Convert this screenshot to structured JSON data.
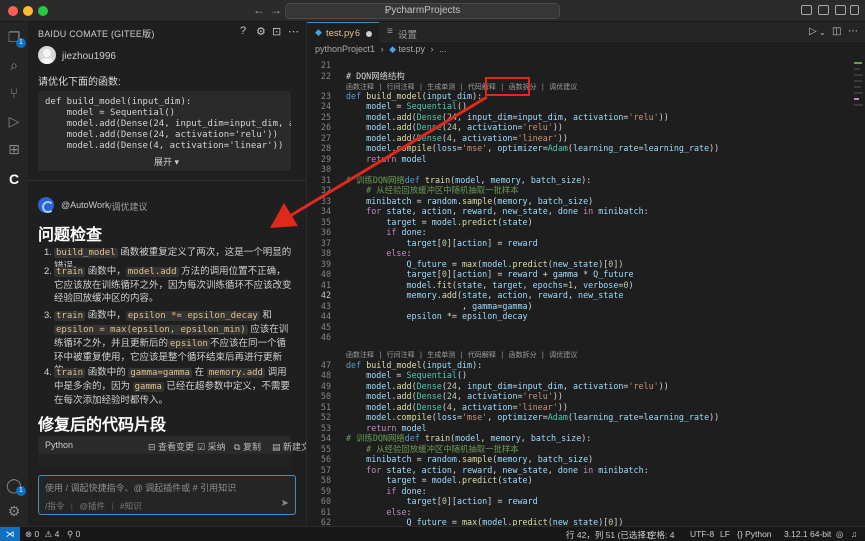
{
  "titlebar": {
    "search_text": "PycharmProjects",
    "back_icon": "arrow-left-icon",
    "forward_icon": "arrow-right-icon"
  },
  "panel": {
    "title": "BAIDU COMATE (GITEE版)",
    "user_name": "jiezhou1996",
    "user_message": "请优化下面的函数:",
    "code_lines": [
      "def build_model(input_dim):",
      "    model = Sequential()",
      "    model.add(Dense(24, input_dim=input_dim, activation=",
      "    model.add(Dense(24, activation='relu'))",
      "    model.add(Dense(4, activation='linear'))"
    ],
    "expand_label": "展开 ▾",
    "ai_name": "@AutoWork",
    "ai_command": "/调优建议",
    "heading_problems": "问题检查",
    "items": [
      {
        "num": "1.",
        "code": "build_model",
        "text": " 函数被重复定义了两次，这是一个明显的错误。"
      },
      {
        "num": "2.",
        "pre": "train",
        "mid1": " 函数中，",
        "code": "model.add",
        "text": " 方法的调用位置不正确，它应该放在训练循环之外，因为每次训练循环不应该改变经验回放缓冲区的内容。"
      },
      {
        "num": "3.",
        "pre": "train",
        "mid1": " 函数中，",
        "code": "epsilon *= epsilon_decay",
        "mid2": " 和 ",
        "code2": "epsilon = max(epsilon, epsilon_min)",
        "text": " 应该在训练循环之外，并且更新后的",
        "code3": "epsilon",
        "text2": "不应该在同一个循环中被重复使用，它应该是整个循环结束后再进行更新的。"
      },
      {
        "num": "4.",
        "pre": "train",
        "mid1": " 函数中的 ",
        "code": "gamma=gamma",
        "mid2": " 在 ",
        "code2": "memory.add",
        "text": " 调用中是多余的，因为 ",
        "code3": "gamma",
        "text2": " 已经在超参数中定义，不需要在每次添加经验时都传入。"
      }
    ],
    "heading_fixed": "修复后的代码片段",
    "snippet_lang": "Python",
    "snippet_actions": [
      "查看变更",
      "采纳",
      "复制",
      "新建文件"
    ],
    "input_placeholder": "使用 / 调起快捷指令、@ 调起插件或 # 引用知识",
    "input_tools": [
      "/指令",
      "@插件",
      "#知识"
    ]
  },
  "tabs": [
    {
      "label": "test.py",
      "count": "6",
      "modified": true
    },
    {
      "label": "设置"
    }
  ],
  "breadcrumb": [
    "pythonProject1",
    "test.py",
    "..."
  ],
  "editor": {
    "lens_text": "函数注释 | 行间注释 | 生成单测 | 代码解释 | 函数拆分 | 调优建议",
    "lens_highlight": "调优建议",
    "cursor_line": "42"
  },
  "status": {
    "errors": "0",
    "warnings": "4",
    "ports": "0",
    "position": "行 42，列 51 (已选择1)",
    "spaces": "空格: 4",
    "encoding": "UTF-8",
    "eol": "LF",
    "language": "Python",
    "interpreter": "3.12.1 64-bit"
  },
  "colors": {
    "accent": "#0e70c0",
    "annotation_red": "#e0291d",
    "modified_file": "#e2c08d"
  }
}
